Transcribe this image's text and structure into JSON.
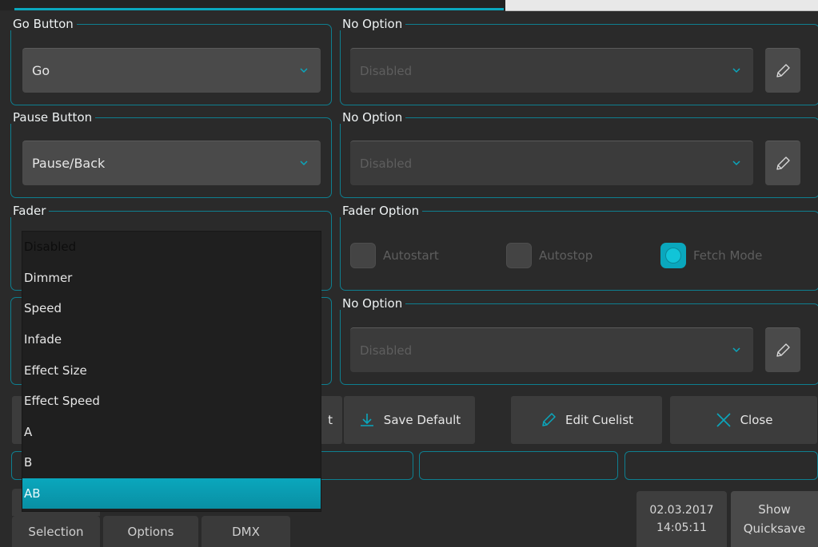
{
  "groups": {
    "go_button": {
      "legend": "Go Button",
      "value": "Go"
    },
    "go_option": {
      "legend": "No Option",
      "value": "Disabled"
    },
    "pause_button": {
      "legend": "Pause Button",
      "value": "Pause/Back"
    },
    "pause_option": {
      "legend": "No Option",
      "value": "Disabled"
    },
    "fader": {
      "legend": "Fader"
    },
    "fader_option": {
      "legend": "Fader Option",
      "autostart": "Autostart",
      "autostop": "Autostop",
      "fetch_mode": "Fetch Mode"
    },
    "third_option": {
      "legend": "No Option",
      "value": "Disabled"
    }
  },
  "fader_dropdown": {
    "options": [
      "Disabled",
      "Dimmer",
      "Speed",
      "Infade",
      "Effect Size",
      "Effect Speed",
      "A",
      "B",
      "AB"
    ],
    "selected": "AB"
  },
  "actions": {
    "hidden_partial": "t",
    "save_default": "Save Default",
    "edit_cuelist": "Edit Cuelist",
    "close": "Close"
  },
  "tabs": [
    "Selection",
    "Options",
    "DMX"
  ],
  "status": {
    "date": "02.03.2017",
    "time": "14:05:11",
    "show": "Show",
    "quicksave": "Quicksave"
  },
  "icons": {
    "chevron": "chevron-down-icon",
    "edit": "pencil-icon",
    "download": "download-icon",
    "close": "x-icon"
  },
  "colors": {
    "accent": "#0aa7bd",
    "background": "#2a2a2a",
    "border": "#0e7f90"
  }
}
